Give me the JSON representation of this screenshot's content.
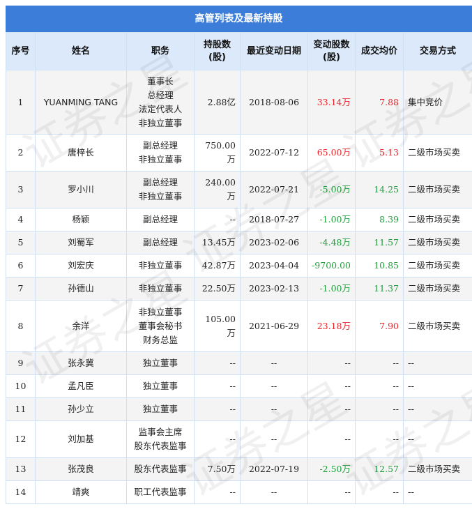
{
  "title": "高管列表及最新持股",
  "colors": {
    "header_bg": "#3b7dd8",
    "up": "#e8262c",
    "down": "#1f9d3b"
  },
  "watermark": "证券之星",
  "columns": [
    "序号",
    "姓名",
    "职务",
    "持股数(股)",
    "最近变动日期",
    "变动股数(股)",
    "成交均价",
    "交易方式"
  ],
  "rows": [
    {
      "no": "1",
      "name": "YUANMING TANG",
      "roles": [
        "董事长",
        "总经理",
        "法定代表人",
        "非独立董事"
      ],
      "shares": "2.88亿",
      "date": "2018-08-06",
      "change": "33.14万",
      "change_dir": "up",
      "price": "7.88",
      "price_dir": "up",
      "method": "集中竞价"
    },
    {
      "no": "2",
      "name": "唐梓长",
      "roles": [
        "副总经理",
        "非独立董事"
      ],
      "shares": "750.00万",
      "date": "2022-07-12",
      "change": "65.00万",
      "change_dir": "up",
      "price": "5.13",
      "price_dir": "up",
      "method": "二级市场买卖"
    },
    {
      "no": "3",
      "name": "罗小川",
      "roles": [
        "副总经理",
        "非独立董事"
      ],
      "shares": "240.00万",
      "date": "2022-07-21",
      "change": "-5.00万",
      "change_dir": "down",
      "price": "14.25",
      "price_dir": "down",
      "method": "二级市场买卖"
    },
    {
      "no": "4",
      "name": "杨颖",
      "roles": [
        "副总经理"
      ],
      "shares": "--",
      "date": "2018-07-27",
      "change": "-1.00万",
      "change_dir": "down",
      "price": "8.39",
      "price_dir": "down",
      "method": "二级市场买卖"
    },
    {
      "no": "5",
      "name": "刘蜀军",
      "roles": [
        "副总经理"
      ],
      "shares": "13.45万",
      "date": "2023-02-06",
      "change": "-4.48万",
      "change_dir": "down",
      "price": "11.57",
      "price_dir": "down",
      "method": "二级市场买卖"
    },
    {
      "no": "6",
      "name": "刘宏庆",
      "roles": [
        "非独立董事"
      ],
      "shares": "42.87万",
      "date": "2023-04-04",
      "change": "-9700.00",
      "change_dir": "down",
      "price": "10.85",
      "price_dir": "down",
      "method": "二级市场买卖"
    },
    {
      "no": "7",
      "name": "孙德山",
      "roles": [
        "非独立董事"
      ],
      "shares": "22.50万",
      "date": "2023-02-13",
      "change": "-1.00万",
      "change_dir": "down",
      "price": "11.37",
      "price_dir": "down",
      "method": "二级市场买卖"
    },
    {
      "no": "8",
      "name": "余洋",
      "roles": [
        "非独立董事",
        "董事会秘书",
        "财务总监"
      ],
      "shares": "105.00万",
      "date": "2021-06-29",
      "change": "23.18万",
      "change_dir": "up",
      "price": "7.90",
      "price_dir": "up",
      "method": "二级市场买卖"
    },
    {
      "no": "9",
      "name": "张永冀",
      "roles": [
        "独立董事"
      ],
      "shares": "--",
      "date": "--",
      "change": "--",
      "change_dir": "none",
      "price": "--",
      "price_dir": "none",
      "method": "--"
    },
    {
      "no": "10",
      "name": "孟凡臣",
      "roles": [
        "独立董事"
      ],
      "shares": "--",
      "date": "--",
      "change": "--",
      "change_dir": "none",
      "price": "--",
      "price_dir": "none",
      "method": "--"
    },
    {
      "no": "11",
      "name": "孙少立",
      "roles": [
        "独立董事"
      ],
      "shares": "--",
      "date": "--",
      "change": "--",
      "change_dir": "none",
      "price": "--",
      "price_dir": "none",
      "method": "--"
    },
    {
      "no": "12",
      "name": "刘加基",
      "roles": [
        "监事会主席",
        "股东代表监事"
      ],
      "shares": "--",
      "date": "--",
      "change": "--",
      "change_dir": "none",
      "price": "--",
      "price_dir": "none",
      "method": "--"
    },
    {
      "no": "13",
      "name": "张茂良",
      "roles": [
        "股东代表监事"
      ],
      "shares": "7.50万",
      "date": "2022-07-19",
      "change": "-2.50万",
      "change_dir": "down",
      "price": "12.57",
      "price_dir": "down",
      "method": "二级市场买卖"
    },
    {
      "no": "14",
      "name": "靖爽",
      "roles": [
        "职工代表监事"
      ],
      "shares": "--",
      "date": "--",
      "change": "--",
      "change_dir": "none",
      "price": "--",
      "price_dir": "none",
      "method": "--"
    }
  ]
}
